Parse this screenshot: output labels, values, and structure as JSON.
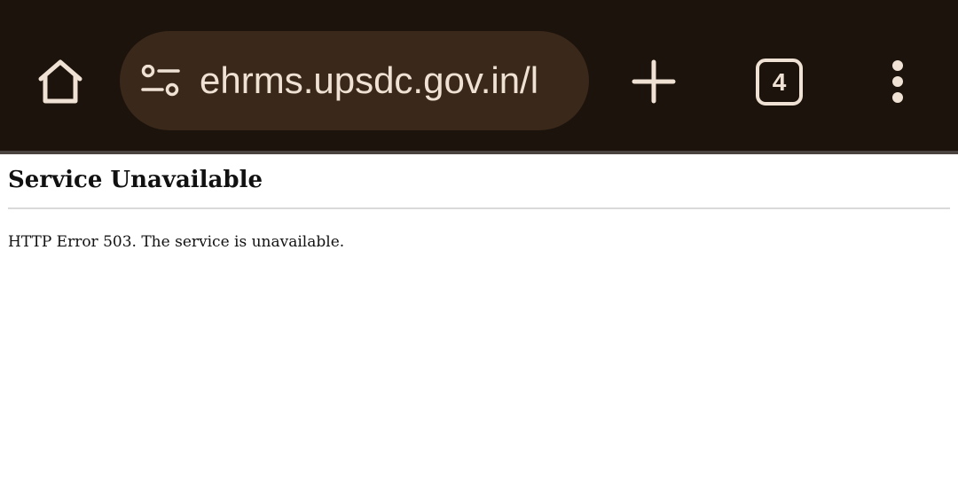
{
  "browser": {
    "url": "ehrms.upsdc.gov.in/l",
    "tab_count": "4",
    "toolbar_color": "#1c130c",
    "omnibox_color": "#3a281a",
    "icon_color": "#efe2d4",
    "icons": {
      "home": "home-icon",
      "site_info": "tune-icon",
      "new_tab": "plus-icon",
      "tabs": "tab-switcher-icon",
      "menu": "more-vert-icon"
    }
  },
  "page": {
    "title": "Service Unavailable",
    "message": "HTTP Error 503. The service is unavailable."
  }
}
